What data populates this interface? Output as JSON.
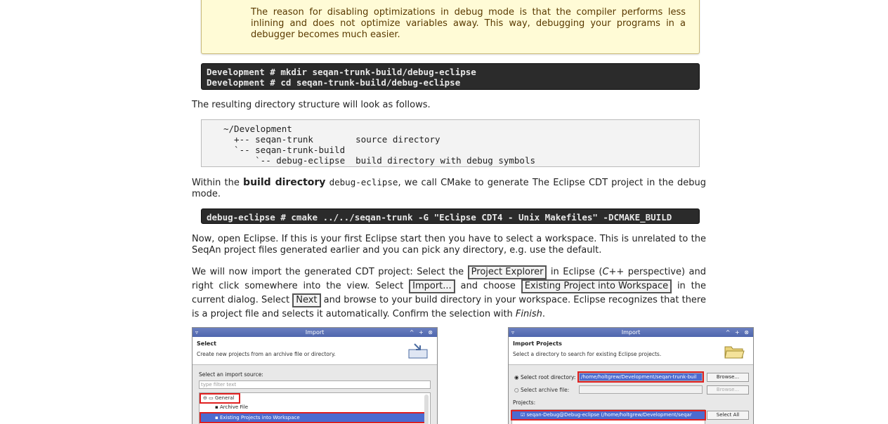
{
  "note": {
    "text": "The reason for disabling optimizations in debug mode is that the compiler performs less inlining and does not optimize variables away. This way, debugging your programs in a debugger becomes much easier."
  },
  "console1": {
    "lines": "Development # mkdir seqan-trunk-build/debug-eclipse\nDevelopment # cd seqan-trunk-build/debug-eclipse"
  },
  "para1": "The resulting directory structure will look as follows.",
  "tree": {
    "text": "~/Development\n  +-- seqan-trunk        source directory\n  `-- seqan-trunk-build\n      `-- debug-eclipse  build directory with debug symbols"
  },
  "para2": {
    "a": "Within the ",
    "b": "build directory",
    "c": " ",
    "code": "debug-eclipse",
    "d": ", we call CMake to generate The Eclipse CDT project in the debug mode."
  },
  "console2": {
    "lines": "debug-eclipse # cmake ../../seqan-trunk -G \"Eclipse CDT4 - Unix Makefiles\" -DCMAKE_BUILD"
  },
  "para3": "Now, open Eclipse. If this is your first Eclipse start then you have to select a workspace. This is unrelated to the SeqAn project files generated earlier and you can pick any directory, e.g. use the default.",
  "para4": {
    "a": "We will now import the generated CDT project: Select the ",
    "btn1": "Project Explorer",
    "b": " in Eclipse (",
    "em1": "C++",
    "c": " perspective) and right click somewhere into the view. Select ",
    "btn2": "Import...",
    "d": " and choose ",
    "btn3": "Existing Project into Workspace",
    "e": " in the current dialog. Select ",
    "btn4": "Next",
    "f": " and browse to your build directory in your workspace. Eclipse recognizes that there is a project file and selects it automatically. Confirm the selection with ",
    "em2": "Finish",
    "g": "."
  },
  "shot1": {
    "title": "Import",
    "window_controls": "^ + ⊗",
    "heading": "Select",
    "subheading": "Create new projects from an archive file or directory.",
    "source_label": "Select an import source:",
    "filter_placeholder": "type filter text",
    "tree_general": "General",
    "tree_archive": "Archive File",
    "tree_existing": "Existing Projects into Workspace"
  },
  "shot2": {
    "title": "Import",
    "window_controls": "^ + ⊗",
    "heading": "Import Projects",
    "subheading": "Select a directory to search for existing Eclipse projects.",
    "root_label": "Select root directory:",
    "root_value": "/home/holtgrew/Development/seqan-trunk-buil",
    "browse1": "Browse...",
    "archive_label": "Select archive file:",
    "browse2": "Browse...",
    "projects_label": "Projects:",
    "project_item": "seqan-Debug@Debug-eclipse (/home/holtgrew/Development/seqar",
    "select_all": "Select All"
  }
}
